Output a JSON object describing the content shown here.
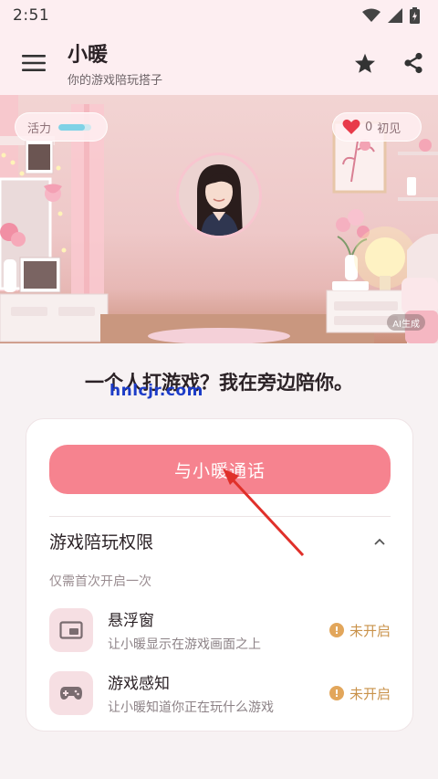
{
  "status_bar": {
    "time": "2:51"
  },
  "app_bar": {
    "title": "小暖",
    "subtitle": "你的游戏陪玩搭子"
  },
  "hero": {
    "vitality_label": "活力",
    "vitality_level": 0.8,
    "affinity_count": "0",
    "affinity_label": "初见",
    "ai_badge": "AI生成"
  },
  "main": {
    "tagline": "一个人打游戏？我在旁边陪你。",
    "watermark": "hnlcjr.com"
  },
  "card": {
    "call_button": "与小暖通话",
    "permissions_title": "游戏陪玩权限",
    "permissions_note": "仅需首次开启一次",
    "permissions": [
      {
        "name": "悬浮窗",
        "desc": "让小暖显示在游戏画面之上",
        "status": "未开启",
        "icon": "picture-in-picture-icon"
      },
      {
        "name": "游戏感知",
        "desc": "让小暖知道你正在玩什么游戏",
        "status": "未开启",
        "icon": "gamepad-icon"
      }
    ]
  },
  "colors": {
    "accent": "#f6838f",
    "app_bar_bg": "#fdeef1",
    "warning": "#e2a65b",
    "icon_bg": "#f6dfe3"
  }
}
